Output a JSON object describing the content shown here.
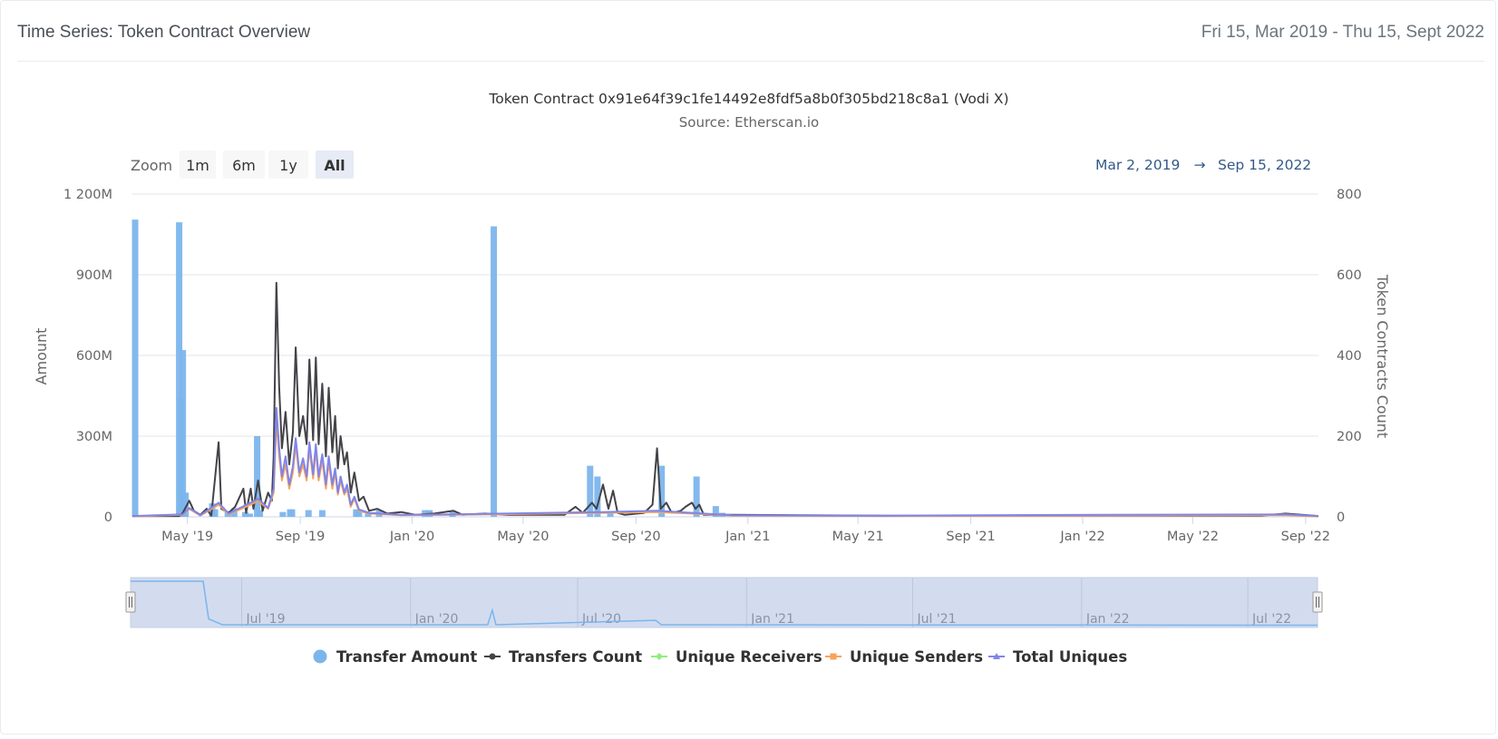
{
  "header": {
    "title": "Time Series: Token Contract Overview",
    "date_range": "Fri 15, Mar 2019 - Thu 15, Sept 2022"
  },
  "zoom": {
    "label": "Zoom",
    "buttons": [
      "1m",
      "6m",
      "1y",
      "All"
    ],
    "selected": "All"
  },
  "range_display": {
    "from": "Mar 2, 2019",
    "arrow": "→",
    "to": "Sep 15, 2022"
  },
  "chart_data": {
    "type": "bar",
    "title": "Token Contract 0x91e64f39c1fe14492e8fdf5a8b0f305bd218c8a1 (Vodi X)",
    "subtitle": "Source: Etherscan.io",
    "ylabel": "Amount",
    "ylabel_right": "Token Contracts Count",
    "ylim": [
      0,
      1200000000
    ],
    "ylim_right": [
      0,
      800
    ],
    "x_range": [
      "2019-03-02",
      "2022-09-15"
    ],
    "yticks": [
      "0",
      "300M",
      "600M",
      "900M",
      "1 200M"
    ],
    "yticks_right": [
      "0",
      "200",
      "400",
      "600",
      "800"
    ],
    "xticks": [
      {
        "date": "2019-05-01",
        "label": "May '19"
      },
      {
        "date": "2019-09-01",
        "label": "Sep '19"
      },
      {
        "date": "2020-01-01",
        "label": "Jan '20"
      },
      {
        "date": "2020-05-01",
        "label": "May '20"
      },
      {
        "date": "2020-09-01",
        "label": "Sep '20"
      },
      {
        "date": "2021-01-01",
        "label": "Jan '21"
      },
      {
        "date": "2021-05-01",
        "label": "May '21"
      },
      {
        "date": "2021-09-01",
        "label": "Sep '21"
      },
      {
        "date": "2022-01-01",
        "label": "Jan '22"
      },
      {
        "date": "2022-05-01",
        "label": "May '22"
      },
      {
        "date": "2022-09-01",
        "label": "Sep '22"
      }
    ],
    "navigator_ticks": [
      {
        "date": "2019-07-01",
        "label": "Jul '19"
      },
      {
        "date": "2020-01-01",
        "label": "Jan '20"
      },
      {
        "date": "2020-07-01",
        "label": "Jul '20"
      },
      {
        "date": "2021-01-01",
        "label": "Jan '21"
      },
      {
        "date": "2021-07-01",
        "label": "Jul '21"
      },
      {
        "date": "2022-01-01",
        "label": "Jan '22"
      },
      {
        "date": "2022-07-01",
        "label": "Jul '22"
      }
    ],
    "series": [
      {
        "name": "Transfer Amount",
        "type": "column",
        "axis": "left",
        "color": "#7cb5ec",
        "points": [
          [
            "2019-03-05",
            1105000000
          ],
          [
            "2019-04-22",
            1095000000
          ],
          [
            "2019-04-24",
            440000000
          ],
          [
            "2019-04-26",
            620000000
          ],
          [
            "2019-04-29",
            90000000
          ],
          [
            "2019-05-28",
            50000000
          ],
          [
            "2019-05-31",
            28000000
          ],
          [
            "2019-06-14",
            22000000
          ],
          [
            "2019-06-21",
            32000000
          ],
          [
            "2019-07-03",
            18000000
          ],
          [
            "2019-07-08",
            12000000
          ],
          [
            "2019-07-16",
            300000000
          ],
          [
            "2019-07-19",
            25000000
          ],
          [
            "2019-08-13",
            18000000
          ],
          [
            "2019-08-21",
            28000000
          ],
          [
            "2019-08-23",
            28000000
          ],
          [
            "2019-09-10",
            25000000
          ],
          [
            "2019-09-25",
            25000000
          ],
          [
            "2019-11-01",
            28000000
          ],
          [
            "2019-11-04",
            28000000
          ],
          [
            "2019-11-14",
            12000000
          ],
          [
            "2019-11-26",
            25000000
          ],
          [
            "2020-01-15",
            25000000
          ],
          [
            "2020-01-20",
            25000000
          ],
          [
            "2020-02-14",
            20000000
          ],
          [
            "2020-03-30",
            1080000000
          ],
          [
            "2020-07-13",
            190000000
          ],
          [
            "2020-07-21",
            150000000
          ],
          [
            "2020-08-04",
            20000000
          ],
          [
            "2020-09-29",
            190000000
          ],
          [
            "2020-11-06",
            150000000
          ],
          [
            "2020-11-27",
            40000000
          ],
          [
            "2020-12-04",
            15000000
          ]
        ]
      },
      {
        "name": "Transfers Count",
        "type": "line",
        "axis": "right",
        "color": "#434348",
        "points": [
          [
            "2019-03-02",
            2
          ],
          [
            "2019-04-22",
            2
          ],
          [
            "2019-04-26",
            10
          ],
          [
            "2019-05-03",
            40
          ],
          [
            "2019-05-08",
            15
          ],
          [
            "2019-05-15",
            5
          ],
          [
            "2019-05-22",
            20
          ],
          [
            "2019-05-27",
            3
          ],
          [
            "2019-06-04",
            185
          ],
          [
            "2019-06-07",
            20
          ],
          [
            "2019-06-15",
            10
          ],
          [
            "2019-06-22",
            25
          ],
          [
            "2019-07-01",
            70
          ],
          [
            "2019-07-04",
            10
          ],
          [
            "2019-07-09",
            70
          ],
          [
            "2019-07-12",
            20
          ],
          [
            "2019-07-17",
            90
          ],
          [
            "2019-07-22",
            15
          ],
          [
            "2019-07-28",
            60
          ],
          [
            "2019-08-01",
            40
          ],
          [
            "2019-08-03",
            150
          ],
          [
            "2019-08-06",
            580
          ],
          [
            "2019-08-09",
            320
          ],
          [
            "2019-08-12",
            170
          ],
          [
            "2019-08-16",
            260
          ],
          [
            "2019-08-20",
            130
          ],
          [
            "2019-08-24",
            210
          ],
          [
            "2019-08-27",
            420
          ],
          [
            "2019-08-31",
            200
          ],
          [
            "2019-09-04",
            250
          ],
          [
            "2019-09-08",
            180
          ],
          [
            "2019-09-11",
            390
          ],
          [
            "2019-09-15",
            190
          ],
          [
            "2019-09-18",
            395
          ],
          [
            "2019-09-21",
            180
          ],
          [
            "2019-09-25",
            330
          ],
          [
            "2019-09-29",
            150
          ],
          [
            "2019-10-02",
            320
          ],
          [
            "2019-10-06",
            160
          ],
          [
            "2019-10-09",
            250
          ],
          [
            "2019-10-12",
            120
          ],
          [
            "2019-10-15",
            200
          ],
          [
            "2019-10-19",
            130
          ],
          [
            "2019-10-22",
            160
          ],
          [
            "2019-10-26",
            60
          ],
          [
            "2019-10-30",
            110
          ],
          [
            "2019-11-04",
            40
          ],
          [
            "2019-11-09",
            50
          ],
          [
            "2019-11-15",
            15
          ],
          [
            "2019-11-24",
            20
          ],
          [
            "2019-12-05",
            8
          ],
          [
            "2019-12-20",
            12
          ],
          [
            "2020-01-05",
            5
          ],
          [
            "2020-01-25",
            8
          ],
          [
            "2020-02-15",
            15
          ],
          [
            "2020-02-25",
            5
          ],
          [
            "2020-03-20",
            8
          ],
          [
            "2020-04-15",
            5
          ],
          [
            "2020-05-20",
            5
          ],
          [
            "2020-06-15",
            5
          ],
          [
            "2020-06-27",
            25
          ],
          [
            "2020-07-05",
            10
          ],
          [
            "2020-07-15",
            35
          ],
          [
            "2020-07-20",
            20
          ],
          [
            "2020-07-27",
            80
          ],
          [
            "2020-08-02",
            20
          ],
          [
            "2020-08-07",
            65
          ],
          [
            "2020-08-12",
            10
          ],
          [
            "2020-08-20",
            5
          ],
          [
            "2020-09-10",
            10
          ],
          [
            "2020-09-19",
            30
          ],
          [
            "2020-09-24",
            170
          ],
          [
            "2020-09-28",
            20
          ],
          [
            "2020-10-04",
            35
          ],
          [
            "2020-10-10",
            10
          ],
          [
            "2020-10-20",
            15
          ],
          [
            "2020-10-25",
            25
          ],
          [
            "2020-11-01",
            35
          ],
          [
            "2020-11-05",
            20
          ],
          [
            "2020-11-09",
            30
          ],
          [
            "2020-11-14",
            5
          ],
          [
            "2020-12-15",
            5
          ],
          [
            "2021-03-01",
            4
          ],
          [
            "2021-06-01",
            3
          ],
          [
            "2022-01-01",
            3
          ],
          [
            "2022-07-15",
            3
          ],
          [
            "2022-08-10",
            8
          ],
          [
            "2022-09-15",
            2
          ]
        ]
      },
      {
        "name": "Unique Receivers",
        "type": "line",
        "axis": "right",
        "color": "#90ed7d",
        "points": []
      },
      {
        "name": "Unique Senders",
        "type": "line",
        "axis": "right",
        "color": "#f7a35c",
        "points": [
          [
            "2019-03-02",
            1
          ],
          [
            "2019-04-26",
            5
          ],
          [
            "2019-05-03",
            20
          ],
          [
            "2019-05-15",
            3
          ],
          [
            "2019-06-04",
            30
          ],
          [
            "2019-06-15",
            6
          ],
          [
            "2019-07-09",
            30
          ],
          [
            "2019-07-17",
            40
          ],
          [
            "2019-07-28",
            20
          ],
          [
            "2019-08-03",
            60
          ],
          [
            "2019-08-06",
            240
          ],
          [
            "2019-08-09",
            150
          ],
          [
            "2019-08-12",
            90
          ],
          [
            "2019-08-16",
            130
          ],
          [
            "2019-08-20",
            70
          ],
          [
            "2019-08-24",
            110
          ],
          [
            "2019-08-27",
            180
          ],
          [
            "2019-08-31",
            100
          ],
          [
            "2019-09-04",
            130
          ],
          [
            "2019-09-08",
            90
          ],
          [
            "2019-09-11",
            170
          ],
          [
            "2019-09-15",
            95
          ],
          [
            "2019-09-18",
            165
          ],
          [
            "2019-09-21",
            90
          ],
          [
            "2019-09-25",
            140
          ],
          [
            "2019-09-29",
            70
          ],
          [
            "2019-10-02",
            135
          ],
          [
            "2019-10-06",
            70
          ],
          [
            "2019-10-09",
            110
          ],
          [
            "2019-10-12",
            55
          ],
          [
            "2019-10-15",
            90
          ],
          [
            "2019-10-19",
            55
          ],
          [
            "2019-10-22",
            70
          ],
          [
            "2019-10-26",
            25
          ],
          [
            "2019-10-30",
            45
          ],
          [
            "2019-11-04",
            15
          ],
          [
            "2019-11-15",
            8
          ],
          [
            "2019-12-20",
            4
          ],
          [
            "2020-02-15",
            5
          ],
          [
            "2020-07-27",
            10
          ],
          [
            "2020-09-24",
            12
          ],
          [
            "2020-11-01",
            8
          ],
          [
            "2020-12-15",
            3
          ],
          [
            "2021-06-01",
            2
          ],
          [
            "2022-08-10",
            4
          ],
          [
            "2022-09-15",
            1
          ]
        ]
      },
      {
        "name": "Total Uniques",
        "type": "line",
        "axis": "right",
        "color": "#8085e9",
        "points": [
          [
            "2019-03-02",
            2
          ],
          [
            "2019-04-26",
            6
          ],
          [
            "2019-05-03",
            22
          ],
          [
            "2019-05-15",
            4
          ],
          [
            "2019-06-04",
            35
          ],
          [
            "2019-06-15",
            8
          ],
          [
            "2019-07-09",
            35
          ],
          [
            "2019-07-17",
            45
          ],
          [
            "2019-07-28",
            22
          ],
          [
            "2019-08-03",
            70
          ],
          [
            "2019-08-06",
            270
          ],
          [
            "2019-08-09",
            170
          ],
          [
            "2019-08-12",
            100
          ],
          [
            "2019-08-16",
            150
          ],
          [
            "2019-08-20",
            80
          ],
          [
            "2019-08-24",
            125
          ],
          [
            "2019-08-27",
            195
          ],
          [
            "2019-08-31",
            110
          ],
          [
            "2019-09-04",
            145
          ],
          [
            "2019-09-08",
            100
          ],
          [
            "2019-09-11",
            185
          ],
          [
            "2019-09-15",
            105
          ],
          [
            "2019-09-18",
            180
          ],
          [
            "2019-09-21",
            100
          ],
          [
            "2019-09-25",
            155
          ],
          [
            "2019-09-29",
            80
          ],
          [
            "2019-10-02",
            150
          ],
          [
            "2019-10-06",
            80
          ],
          [
            "2019-10-09",
            120
          ],
          [
            "2019-10-12",
            60
          ],
          [
            "2019-10-15",
            100
          ],
          [
            "2019-10-19",
            60
          ],
          [
            "2019-10-22",
            80
          ],
          [
            "2019-10-26",
            30
          ],
          [
            "2019-10-30",
            50
          ],
          [
            "2019-11-04",
            18
          ],
          [
            "2019-11-15",
            10
          ],
          [
            "2019-12-20",
            5
          ],
          [
            "2020-02-15",
            6
          ],
          [
            "2020-07-27",
            12
          ],
          [
            "2020-09-24",
            15
          ],
          [
            "2020-11-01",
            10
          ],
          [
            "2020-12-15",
            4
          ],
          [
            "2021-06-01",
            3
          ],
          [
            "2022-01-15",
            5
          ],
          [
            "2022-08-10",
            6
          ],
          [
            "2022-09-15",
            2
          ]
        ]
      }
    ]
  }
}
